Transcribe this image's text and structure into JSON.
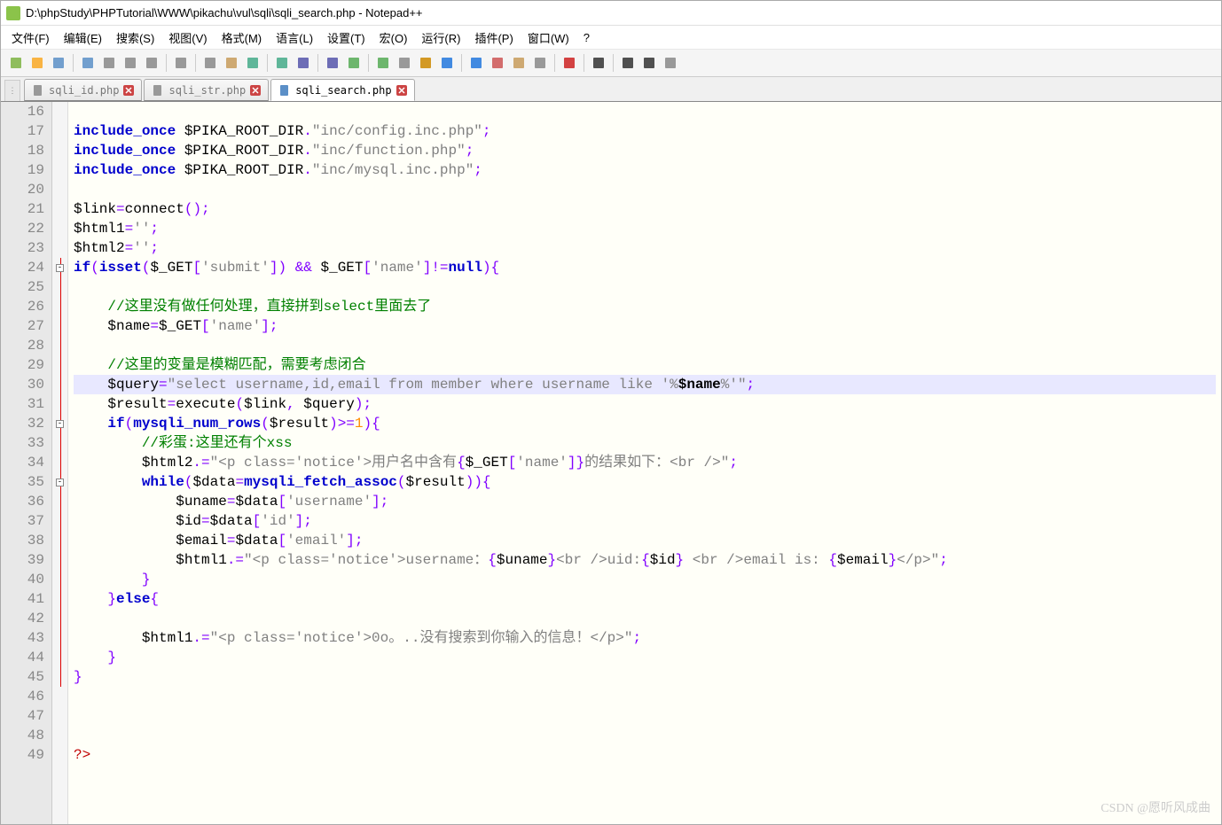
{
  "window": {
    "title": "D:\\phpStudy\\PHPTutorial\\WWW\\pikachu\\vul\\sqli\\sqli_search.php - Notepad++"
  },
  "menu": {
    "file": "文件(F)",
    "edit": "编辑(E)",
    "search": "搜索(S)",
    "view": "视图(V)",
    "format": "格式(M)",
    "language": "语言(L)",
    "settings": "设置(T)",
    "macro": "宏(O)",
    "run": "运行(R)",
    "plugins": "插件(P)",
    "window": "窗口(W)",
    "help": "?"
  },
  "toolbar_icons": [
    "new",
    "open",
    "save",
    "save-all",
    "close",
    "close-all",
    "print",
    "cut",
    "copy",
    "paste",
    "undo",
    "redo",
    "find",
    "replace",
    "zoom-in",
    "zoom-out",
    "sync",
    "wrap",
    "show-chars",
    "indent-guide",
    "lang",
    "folder",
    "eye",
    "record",
    "stop",
    "play",
    "play-multi",
    "list"
  ],
  "tabs": [
    {
      "label": "sqli_id.php",
      "active": false
    },
    {
      "label": "sqli_str.php",
      "active": false
    },
    {
      "label": "sqli_search.php",
      "active": true
    }
  ],
  "lines": {
    "start": 16,
    "end": 49,
    "highlight": 30,
    "fold_start": [
      "24"
    ],
    "fold_boxes": {
      "24": "-",
      "32": "-",
      "35": "-"
    },
    "content": {
      "16": [
        {
          "t": "",
          "c": ""
        }
      ],
      "17": [
        {
          "t": "include_once",
          "c": "kw"
        },
        {
          "t": " $PIKA_ROOT_DIR",
          "c": "var"
        },
        {
          "t": ".",
          "c": "op"
        },
        {
          "t": "\"inc/config.inc.php\"",
          "c": "str"
        },
        {
          "t": ";",
          "c": "op"
        }
      ],
      "18": [
        {
          "t": "include_once",
          "c": "kw"
        },
        {
          "t": " $PIKA_ROOT_DIR",
          "c": "var"
        },
        {
          "t": ".",
          "c": "op"
        },
        {
          "t": "\"inc/function.php\"",
          "c": "str"
        },
        {
          "t": ";",
          "c": "op"
        }
      ],
      "19": [
        {
          "t": "include_once",
          "c": "kw"
        },
        {
          "t": " $PIKA_ROOT_DIR",
          "c": "var"
        },
        {
          "t": ".",
          "c": "op"
        },
        {
          "t": "\"inc/mysql.inc.php\"",
          "c": "str"
        },
        {
          "t": ";",
          "c": "op"
        }
      ],
      "20": [
        {
          "t": "",
          "c": ""
        }
      ],
      "21": [
        {
          "t": "$link",
          "c": "var"
        },
        {
          "t": "=",
          "c": "op"
        },
        {
          "t": "connect",
          "c": "fn"
        },
        {
          "t": "();",
          "c": "op"
        }
      ],
      "22": [
        {
          "t": "$html1",
          "c": "var"
        },
        {
          "t": "=",
          "c": "op"
        },
        {
          "t": "''",
          "c": "str"
        },
        {
          "t": ";",
          "c": "op"
        }
      ],
      "23": [
        {
          "t": "$html2",
          "c": "var"
        },
        {
          "t": "=",
          "c": "op"
        },
        {
          "t": "''",
          "c": "str"
        },
        {
          "t": ";",
          "c": "op"
        }
      ],
      "24": [
        {
          "t": "if",
          "c": "kw"
        },
        {
          "t": "(",
          "c": "op"
        },
        {
          "t": "isset",
          "c": "kw"
        },
        {
          "t": "(",
          "c": "op"
        },
        {
          "t": "$_GET",
          "c": "var"
        },
        {
          "t": "[",
          "c": "op"
        },
        {
          "t": "'submit'",
          "c": "str"
        },
        {
          "t": "]) ",
          "c": "op"
        },
        {
          "t": "&&",
          "c": "op"
        },
        {
          "t": " $_GET",
          "c": "var"
        },
        {
          "t": "[",
          "c": "op"
        },
        {
          "t": "'name'",
          "c": "str"
        },
        {
          "t": "]",
          "c": "op"
        },
        {
          "t": "!=",
          "c": "op"
        },
        {
          "t": "null",
          "c": "kw"
        },
        {
          "t": "){",
          "c": "op"
        }
      ],
      "25": [
        {
          "t": "",
          "c": ""
        }
      ],
      "26": [
        {
          "t": "    //这里没有做任何处理，直接拼到select里面去了",
          "c": "cmt"
        }
      ],
      "27": [
        {
          "t": "    $name",
          "c": "var"
        },
        {
          "t": "=",
          "c": "op"
        },
        {
          "t": "$_GET",
          "c": "var"
        },
        {
          "t": "[",
          "c": "op"
        },
        {
          "t": "'name'",
          "c": "str"
        },
        {
          "t": "];",
          "c": "op"
        }
      ],
      "28": [
        {
          "t": "",
          "c": ""
        }
      ],
      "29": [
        {
          "t": "    //这里的变量是模糊匹配，需要考虑闭合",
          "c": "cmt"
        }
      ],
      "30": [
        {
          "t": "    $query",
          "c": "var"
        },
        {
          "t": "=",
          "c": "op"
        },
        {
          "t": "\"select username,id,email from member where username like '%",
          "c": "str"
        },
        {
          "t": "$name",
          "c": "var bold"
        },
        {
          "t": "%'\"",
          "c": "str"
        },
        {
          "t": ";",
          "c": "op"
        }
      ],
      "31": [
        {
          "t": "    $result",
          "c": "var"
        },
        {
          "t": "=",
          "c": "op"
        },
        {
          "t": "execute",
          "c": "fn"
        },
        {
          "t": "(",
          "c": "op"
        },
        {
          "t": "$link",
          "c": "var"
        },
        {
          "t": ", ",
          "c": "op"
        },
        {
          "t": "$query",
          "c": "var"
        },
        {
          "t": ");",
          "c": "op"
        }
      ],
      "32": [
        {
          "t": "    if",
          "c": "kw"
        },
        {
          "t": "(",
          "c": "op"
        },
        {
          "t": "mysqli_num_rows",
          "c": "kw bold"
        },
        {
          "t": "(",
          "c": "op"
        },
        {
          "t": "$result",
          "c": "var"
        },
        {
          "t": ")",
          "c": "op"
        },
        {
          "t": ">=",
          "c": "op"
        },
        {
          "t": "1",
          "c": "num"
        },
        {
          "t": "){",
          "c": "op"
        }
      ],
      "33": [
        {
          "t": "        //彩蛋:这里还有个xss",
          "c": "cmt"
        }
      ],
      "34": [
        {
          "t": "        $html2",
          "c": "var"
        },
        {
          "t": ".=",
          "c": "op"
        },
        {
          "t": "\"<p class='notice'>用户名中含有",
          "c": "str"
        },
        {
          "t": "{",
          "c": "op"
        },
        {
          "t": "$_GET",
          "c": "var"
        },
        {
          "t": "[",
          "c": "op"
        },
        {
          "t": "'name'",
          "c": "str"
        },
        {
          "t": "]",
          "c": "op"
        },
        {
          "t": "}",
          "c": "op"
        },
        {
          "t": "的结果如下：<br />\"",
          "c": "str"
        },
        {
          "t": ";",
          "c": "op"
        }
      ],
      "35": [
        {
          "t": "        while",
          "c": "kw"
        },
        {
          "t": "(",
          "c": "op"
        },
        {
          "t": "$data",
          "c": "var"
        },
        {
          "t": "=",
          "c": "op"
        },
        {
          "t": "mysqli_fetch_assoc",
          "c": "kw bold"
        },
        {
          "t": "(",
          "c": "op"
        },
        {
          "t": "$result",
          "c": "var"
        },
        {
          "t": ")){",
          "c": "op"
        }
      ],
      "36": [
        {
          "t": "            $uname",
          "c": "var"
        },
        {
          "t": "=",
          "c": "op"
        },
        {
          "t": "$data",
          "c": "var"
        },
        {
          "t": "[",
          "c": "op"
        },
        {
          "t": "'username'",
          "c": "str"
        },
        {
          "t": "];",
          "c": "op"
        }
      ],
      "37": [
        {
          "t": "            $id",
          "c": "var"
        },
        {
          "t": "=",
          "c": "op"
        },
        {
          "t": "$data",
          "c": "var"
        },
        {
          "t": "[",
          "c": "op"
        },
        {
          "t": "'id'",
          "c": "str"
        },
        {
          "t": "];",
          "c": "op"
        }
      ],
      "38": [
        {
          "t": "            $email",
          "c": "var"
        },
        {
          "t": "=",
          "c": "op"
        },
        {
          "t": "$data",
          "c": "var"
        },
        {
          "t": "[",
          "c": "op"
        },
        {
          "t": "'email'",
          "c": "str"
        },
        {
          "t": "];",
          "c": "op"
        }
      ],
      "39": [
        {
          "t": "            $html1",
          "c": "var"
        },
        {
          "t": ".=",
          "c": "op"
        },
        {
          "t": "\"<p class='notice'>username：",
          "c": "str"
        },
        {
          "t": "{",
          "c": "op"
        },
        {
          "t": "$uname",
          "c": "var"
        },
        {
          "t": "}",
          "c": "op"
        },
        {
          "t": "<br />uid:",
          "c": "str"
        },
        {
          "t": "{",
          "c": "op"
        },
        {
          "t": "$id",
          "c": "var"
        },
        {
          "t": "}",
          "c": "op"
        },
        {
          "t": " <br />email is: ",
          "c": "str"
        },
        {
          "t": "{",
          "c": "op"
        },
        {
          "t": "$email",
          "c": "var"
        },
        {
          "t": "}",
          "c": "op"
        },
        {
          "t": "</p>\"",
          "c": "str"
        },
        {
          "t": ";",
          "c": "op"
        }
      ],
      "40": [
        {
          "t": "        }",
          "c": "op"
        }
      ],
      "41": [
        {
          "t": "    }",
          "c": "op"
        },
        {
          "t": "else",
          "c": "kw"
        },
        {
          "t": "{",
          "c": "op"
        }
      ],
      "42": [
        {
          "t": "",
          "c": ""
        }
      ],
      "43": [
        {
          "t": "        $html1",
          "c": "var"
        },
        {
          "t": ".=",
          "c": "op"
        },
        {
          "t": "\"<p class='notice'>0o。..没有搜索到你输入的信息！</p>\"",
          "c": "str"
        },
        {
          "t": ";",
          "c": "op"
        }
      ],
      "44": [
        {
          "t": "    }",
          "c": "op"
        }
      ],
      "45": [
        {
          "t": "}",
          "c": "op"
        }
      ],
      "46": [
        {
          "t": "",
          "c": ""
        }
      ],
      "47": [
        {
          "t": "",
          "c": ""
        }
      ],
      "48": [
        {
          "t": "",
          "c": ""
        }
      ],
      "49": [
        {
          "t": "?>",
          "c": "php-tag"
        }
      ]
    }
  },
  "watermark": "CSDN @愿听风成曲"
}
